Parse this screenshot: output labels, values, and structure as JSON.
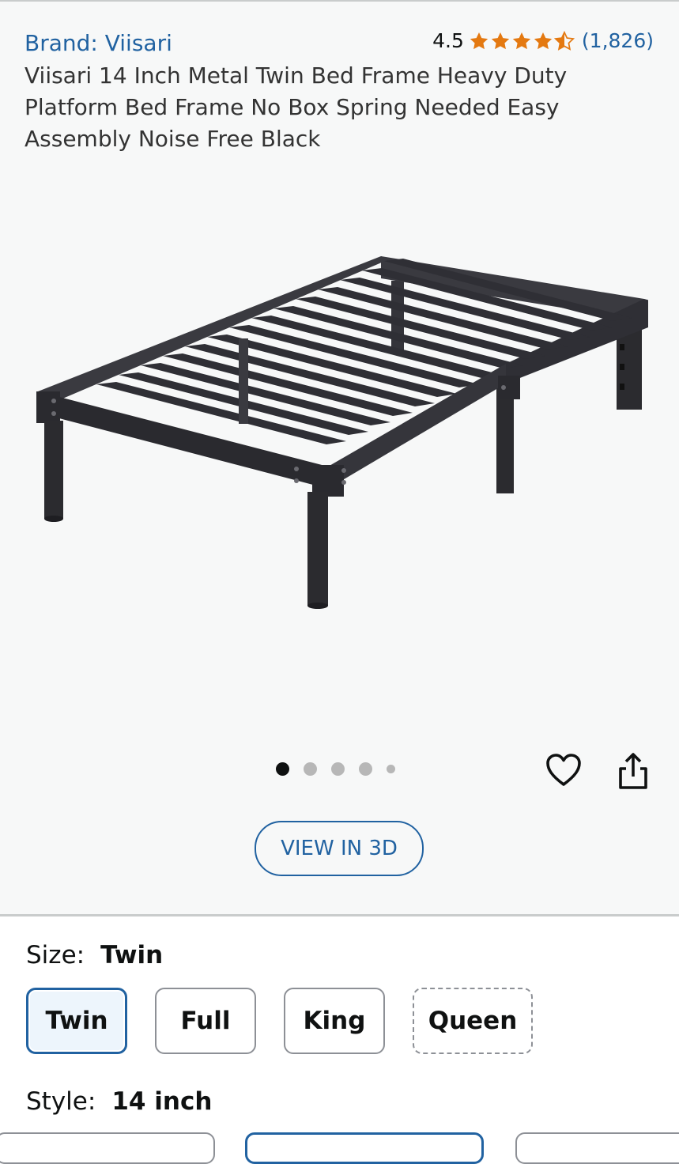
{
  "product": {
    "brand": "Brand: Viisari",
    "rating_value": "4.5",
    "rating_stars": 4.5,
    "rating_count": "(1,826)",
    "title": "Viisari 14 Inch Metal Twin Bed Frame Heavy Duty Platform Bed Frame No Box Spring Needed Easy Assembly Noise Free Black"
  },
  "gallery": {
    "image_count": 5,
    "active_index": 0,
    "view_3d_label": "VIEW IN 3D"
  },
  "size": {
    "label": "Size:",
    "selected": "Twin",
    "options": [
      "Twin",
      "Full",
      "King",
      "Queen"
    ]
  },
  "style": {
    "label": "Style:",
    "selected": "14 inch"
  },
  "colors": {
    "link": "#2162a1",
    "star": "#e47911",
    "selected_bg": "#edf5fc"
  },
  "icons": {
    "wishlist": "heart-outline-icon",
    "share": "share-icon"
  }
}
